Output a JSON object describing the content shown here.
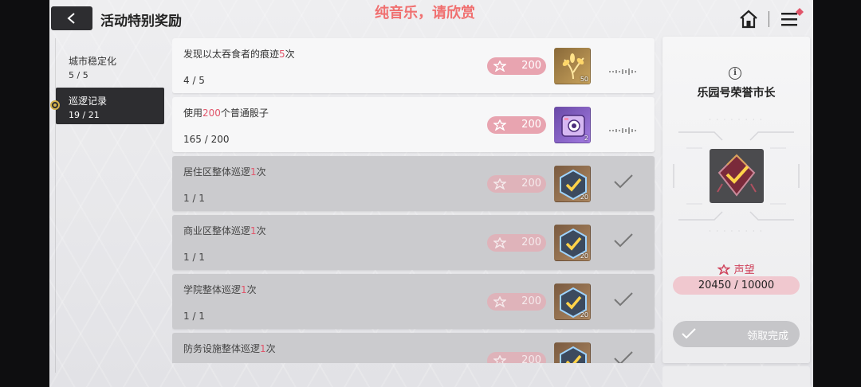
{
  "header": {
    "title": "活动特别奖励",
    "watermark": "纯音乐，请欣赏"
  },
  "nav": {
    "items": [
      {
        "label": "城市稳定化",
        "count": "5 / 5"
      },
      {
        "label": "巡逻记录",
        "count": "19 / 21"
      }
    ]
  },
  "tasks": [
    {
      "title_pre": "发现以太吞食者的痕迹",
      "title_hl": "5",
      "title_post": "次",
      "progress": "4 / 5",
      "reputation": "200",
      "item_icon": "gold-leaf-icon",
      "item_count": "50",
      "status": "in-progress"
    },
    {
      "title_pre": "使用",
      "title_hl": "200",
      "title_post": "个普通骰子",
      "progress": "165 / 200",
      "reputation": "200",
      "item_icon": "camera-cube-icon",
      "item_count": "2",
      "status": "in-progress"
    },
    {
      "title_pre": "居住区整体巡逻",
      "title_hl": "1",
      "title_post": "次",
      "progress": "1 / 1",
      "reputation": "200",
      "item_icon": "check-badge-icon",
      "item_count": "20",
      "status": "completed"
    },
    {
      "title_pre": "商业区整体巡逻",
      "title_hl": "1",
      "title_post": "次",
      "progress": "1 / 1",
      "reputation": "200",
      "item_icon": "check-badge-icon",
      "item_count": "20",
      "status": "completed"
    },
    {
      "title_pre": "学院整体巡逻",
      "title_hl": "1",
      "title_post": "次",
      "progress": "1 / 1",
      "reputation": "200",
      "item_icon": "check-badge-icon",
      "item_count": "20",
      "status": "completed"
    },
    {
      "title_pre": "防务设施整体巡逻",
      "title_hl": "1",
      "title_post": "次",
      "progress": "",
      "reputation": "200",
      "item_icon": "check-badge-icon",
      "item_count": "",
      "status": "completed"
    }
  ],
  "side_panel": {
    "reward_name": "乐园号荣誉市长",
    "rep_label": "声望",
    "rep_value": "20450 / 10000",
    "claim_label": "领取完成"
  },
  "colors": {
    "accent_pink": "#e8a4b0",
    "highlight_red": "#e1556a",
    "dark_panel": "#2d2d30"
  }
}
